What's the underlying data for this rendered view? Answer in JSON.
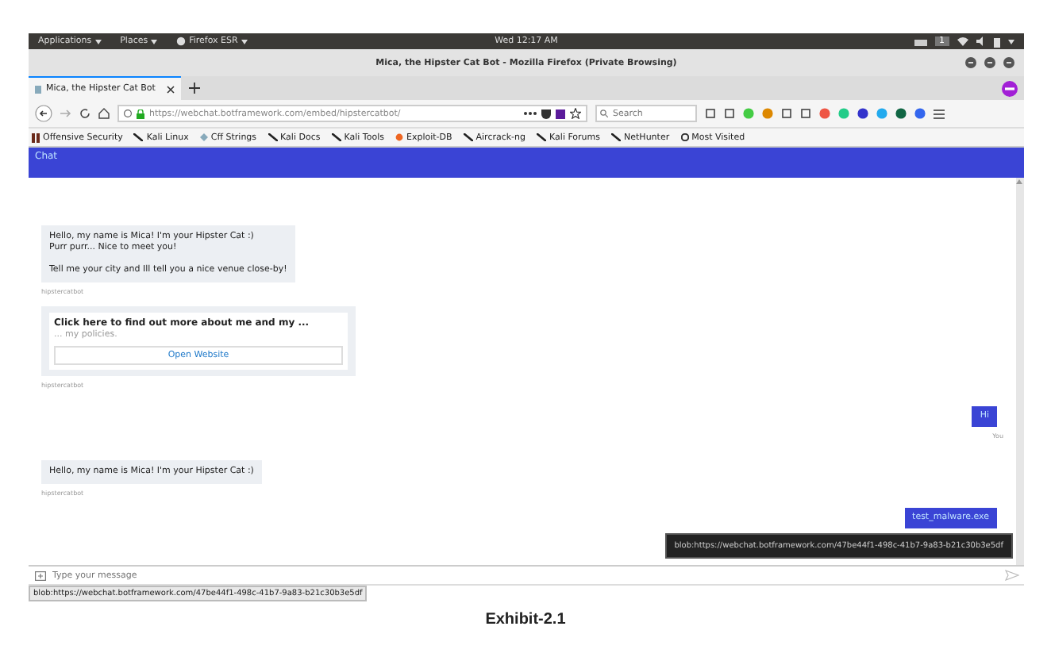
{
  "top_bar": {
    "menus": [
      "Applications",
      "Places",
      "Firefox ESR"
    ],
    "clock": "Wed 12:17 AM",
    "workspace": "1"
  },
  "window": {
    "title": "Mica, the Hipster Cat Bot - Mozilla Firefox (Private Browsing)"
  },
  "tabs": [
    {
      "label": "Mica, the Hipster Cat Bot",
      "selected": true
    }
  ],
  "address_bar": {
    "url": "https://webchat.botframework.com/embed/hipstercatbot/"
  },
  "search": {
    "placeholder": "Search"
  },
  "bookmarks": [
    "Offensive Security",
    "Kali Linux",
    "Cff Strings",
    "Kali Docs",
    "Kali Tools",
    "Exploit-DB",
    "Aircrack-ng",
    "Kali Forums",
    "NetHunter",
    "Most Visited"
  ],
  "chat": {
    "title": "Chat",
    "messages": [
      {
        "kind": "bot_text",
        "paragraphs": [
          "Hello, my name is Mica! I'm your Hipster Cat :)\nPurr purr... Nice to meet you!",
          "Tell me your city and Ill tell you a nice venue close-by!"
        ],
        "sender": "hipstercatbot"
      },
      {
        "kind": "bot_card",
        "title": "Click here to find out more about me and my ...",
        "subtitle": "... my policies.",
        "button": "Open Website",
        "sender": "hipstercatbot"
      },
      {
        "kind": "user",
        "text": "Hi",
        "sender": "You"
      },
      {
        "kind": "bot_text",
        "paragraphs": [
          "Hello, my name is Mica! I'm your Hipster Cat :)"
        ],
        "sender": "hipstercatbot"
      },
      {
        "kind": "user",
        "text": "test_malware.exe"
      }
    ],
    "input": {
      "placeholder": "Type your message"
    },
    "tooltip": "blob:https://webchat.botframework.com/47be44f1-498c-41b7-9a83-b21c30b3e5df"
  },
  "status_bar": "blob:https://webchat.botframework.com/47be44f1-498c-41b7-9a83-b21c30b3e5df",
  "caption": "Exhibit-2.1"
}
